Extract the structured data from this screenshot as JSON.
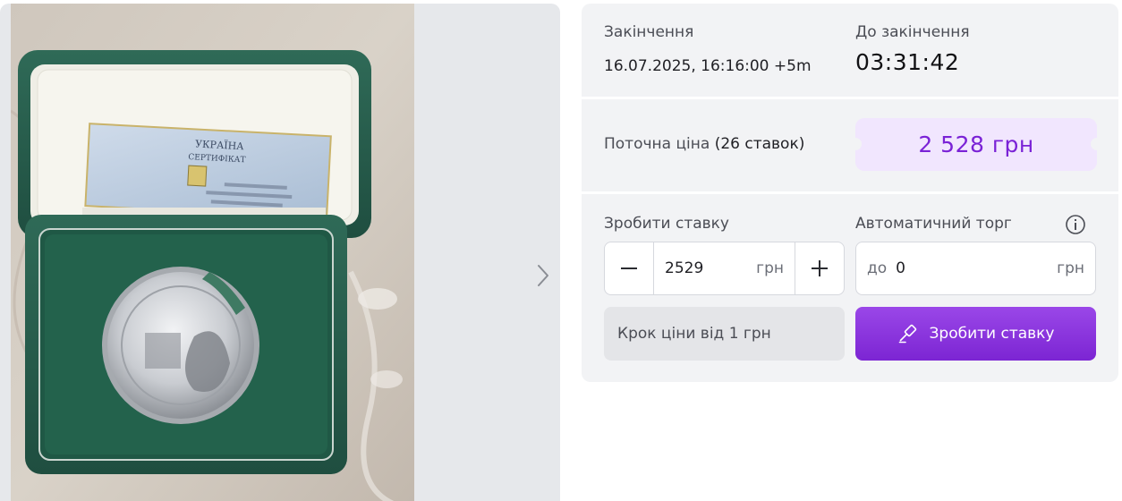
{
  "gallery": {
    "photo": {
      "certificate_lines": [
        "УКРАЇНА",
        "СЕРТИФІКАТ"
      ]
    },
    "next_icon": "chevron-right-icon"
  },
  "auction": {
    "end_label": "Закінчення",
    "end_value": "16.07.2025, 16:16:00 +5m",
    "countdown_label": "До закінчення",
    "countdown_value": "03:31:42",
    "current_price_label": "Поточна ціна",
    "bids_count": "(26 ставок)",
    "current_price": "2 528 грн"
  },
  "bid": {
    "label": "Зробити ставку",
    "amount": "2529",
    "unit": "грн",
    "decrement_icon": "minus-icon",
    "increment_icon": "plus-icon",
    "step_note": "Крок ціни від 1 грн",
    "button_label": "Зробити ставку",
    "button_icon": "gavel-icon"
  },
  "auto_bid": {
    "label": "Автоматичний торг",
    "prefix": "до",
    "amount": "0",
    "unit": "грн",
    "info_icon": "info-icon"
  },
  "colors": {
    "accent": "#7c25d3",
    "price_text": "#7a22d6",
    "price_bg": "#f1e6fe",
    "card_bg": "#f2f3f5"
  }
}
